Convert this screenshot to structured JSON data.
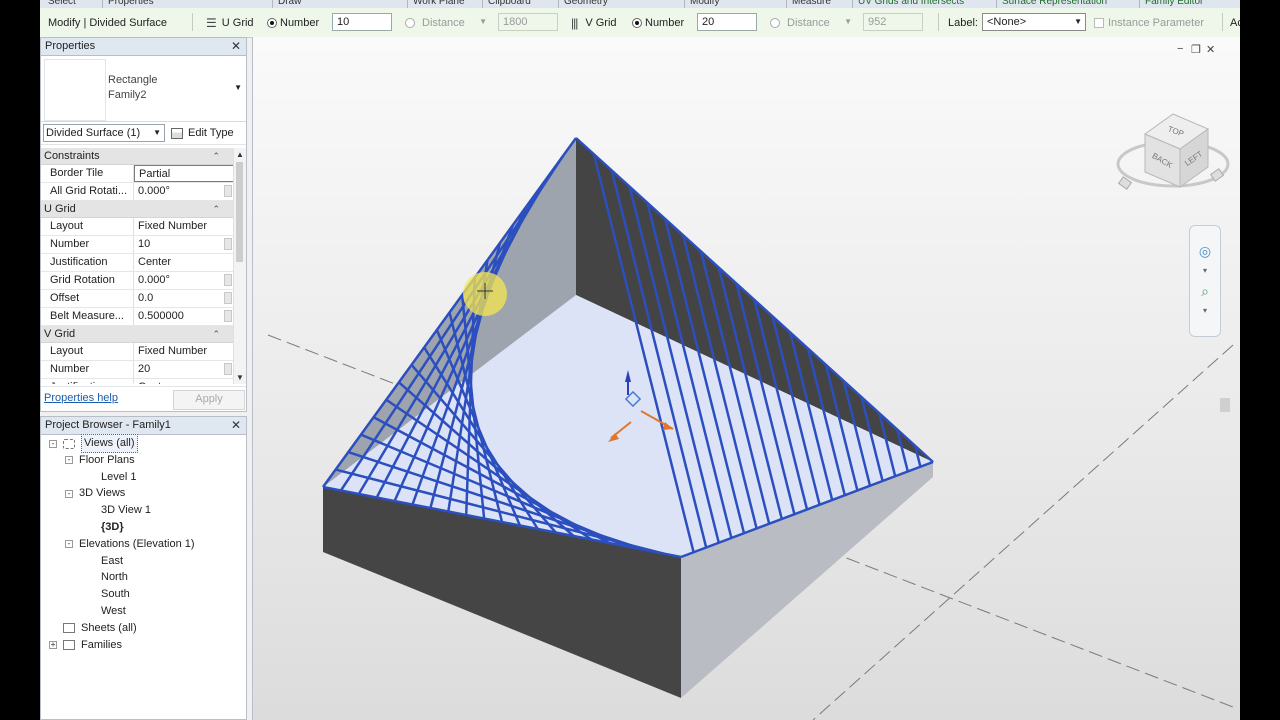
{
  "ribbon": {
    "panels": [
      {
        "label": "Select",
        "contextual": false
      },
      {
        "label": "Properties",
        "contextual": false
      },
      {
        "label": "Draw",
        "contextual": false
      },
      {
        "label": "Work Plane",
        "contextual": false
      },
      {
        "label": "Clipboard",
        "contextual": false
      },
      {
        "label": "Geometry",
        "contextual": false
      },
      {
        "label": "Modify",
        "contextual": false
      },
      {
        "label": "Measure",
        "contextual": false
      },
      {
        "label": "UV Grids and Intersects",
        "contextual": true
      },
      {
        "label": "Surface Representation",
        "contextual": true
      },
      {
        "label": "Family Editor",
        "contextual": true
      }
    ]
  },
  "options_bar": {
    "context_label": "Modify | Divided Surface",
    "u_grid": {
      "label": "U Grid",
      "number_label": "Number",
      "number_value": "10",
      "distance_label": "Distance",
      "distance_value": "1800"
    },
    "v_grid": {
      "label": "V Grid",
      "number_label": "Number",
      "number_value": "20",
      "distance_label": "Distance",
      "distance_value": "952"
    },
    "label_caption": "Label:",
    "label_value": "<None>",
    "instance_parameter": "Instance Parameter",
    "cut_text": "Ac"
  },
  "properties": {
    "title": "Properties",
    "type_name_line1": "Rectangle",
    "type_name_line2": "Family2",
    "instance_filter": "Divided Surface (1)",
    "edit_type": "Edit Type",
    "groups": [
      {
        "name": "Constraints",
        "rows": [
          {
            "name": "Border Tile",
            "value": "Partial",
            "editing": true
          },
          {
            "name": "All Grid Rotati...",
            "value": "0.000°",
            "btn": true
          }
        ]
      },
      {
        "name": "U Grid",
        "rows": [
          {
            "name": "Layout",
            "value": "Fixed Number"
          },
          {
            "name": "Number",
            "value": "10",
            "btn": true
          },
          {
            "name": "Justification",
            "value": "Center"
          },
          {
            "name": "Grid Rotation",
            "value": "0.000°",
            "btn": true
          },
          {
            "name": "Offset",
            "value": "0.0",
            "btn": true
          },
          {
            "name": "Belt Measure...",
            "value": "0.500000",
            "btn": true
          }
        ]
      },
      {
        "name": "V Grid",
        "rows": [
          {
            "name": "Layout",
            "value": "Fixed Number"
          },
          {
            "name": "Number",
            "value": "20",
            "btn": true
          },
          {
            "name": "Justification",
            "value": "Center"
          }
        ]
      }
    ],
    "help_link": "Properties help",
    "apply": "Apply"
  },
  "project_browser": {
    "title": "Project Browser - Family1",
    "nodes": [
      {
        "label": "Views (all)",
        "level": 0,
        "toggle": "-",
        "icon": "views-icon",
        "selected": true
      },
      {
        "label": "Floor Plans",
        "level": 1,
        "toggle": "-"
      },
      {
        "label": "Level 1",
        "level": 2
      },
      {
        "label": "3D Views",
        "level": 1,
        "toggle": "-"
      },
      {
        "label": "3D View 1",
        "level": 2
      },
      {
        "label": "{3D}",
        "level": 2,
        "bold": true
      },
      {
        "label": "Elevations (Elevation 1)",
        "level": 1,
        "toggle": "-"
      },
      {
        "label": "East",
        "level": 2
      },
      {
        "label": "North",
        "level": 2
      },
      {
        "label": "South",
        "level": 2
      },
      {
        "label": "West",
        "level": 2
      },
      {
        "label": "Sheets (all)",
        "level": 0,
        "icon": "sheets-icon"
      },
      {
        "label": "Families",
        "level": 0,
        "toggle": "+",
        "icon": "families-icon"
      }
    ]
  },
  "viewcube": {
    "top_label": "TOP",
    "back_label": "BACK",
    "left_label": "LEFT"
  },
  "model": {
    "u_divisions": 10,
    "v_divisions": 20
  },
  "colors": {
    "grid_line": "#2c4fbf",
    "surface": "#dde3f6",
    "dark_face": "#4a4a4a",
    "context_tab": "#1f6b2a"
  }
}
